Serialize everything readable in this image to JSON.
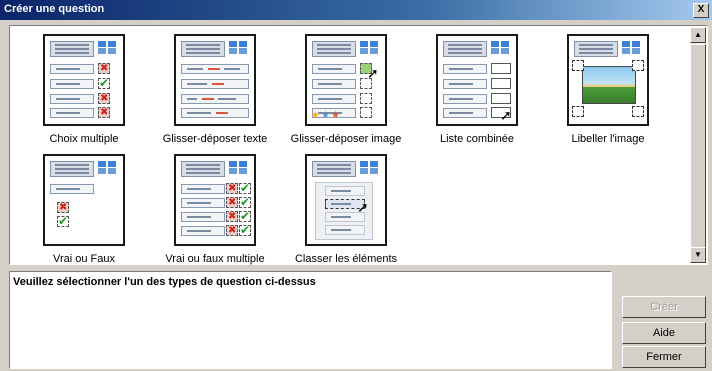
{
  "window": {
    "title": "Créer une question",
    "close_label": "X"
  },
  "question_types": [
    {
      "label": "Choix multiple"
    },
    {
      "label": "Glisser-déposer texte"
    },
    {
      "label": "Glisser-déposer image"
    },
    {
      "label": "Liste combinée"
    },
    {
      "label": "Libeller l'image"
    },
    {
      "label": "Vrai ou Faux"
    },
    {
      "label": "Vrai ou faux multiple"
    },
    {
      "label": "Classer les éléments"
    }
  ],
  "message": {
    "text": "Veuillez sélectionner l'un des types de question ci-dessus"
  },
  "buttons": {
    "create": "Créer",
    "help": "Aide",
    "close": "Fermer"
  },
  "colors": {
    "titlebar_start": "#0a246a",
    "titlebar_end": "#a6caf0",
    "dialog_bg": "#d4d0c8",
    "check": "#1e9a28",
    "cross": "#d02418"
  },
  "icons": {
    "scroll_up": "▲",
    "scroll_down": "▼",
    "pointer": "cursor-arrow-icon"
  }
}
